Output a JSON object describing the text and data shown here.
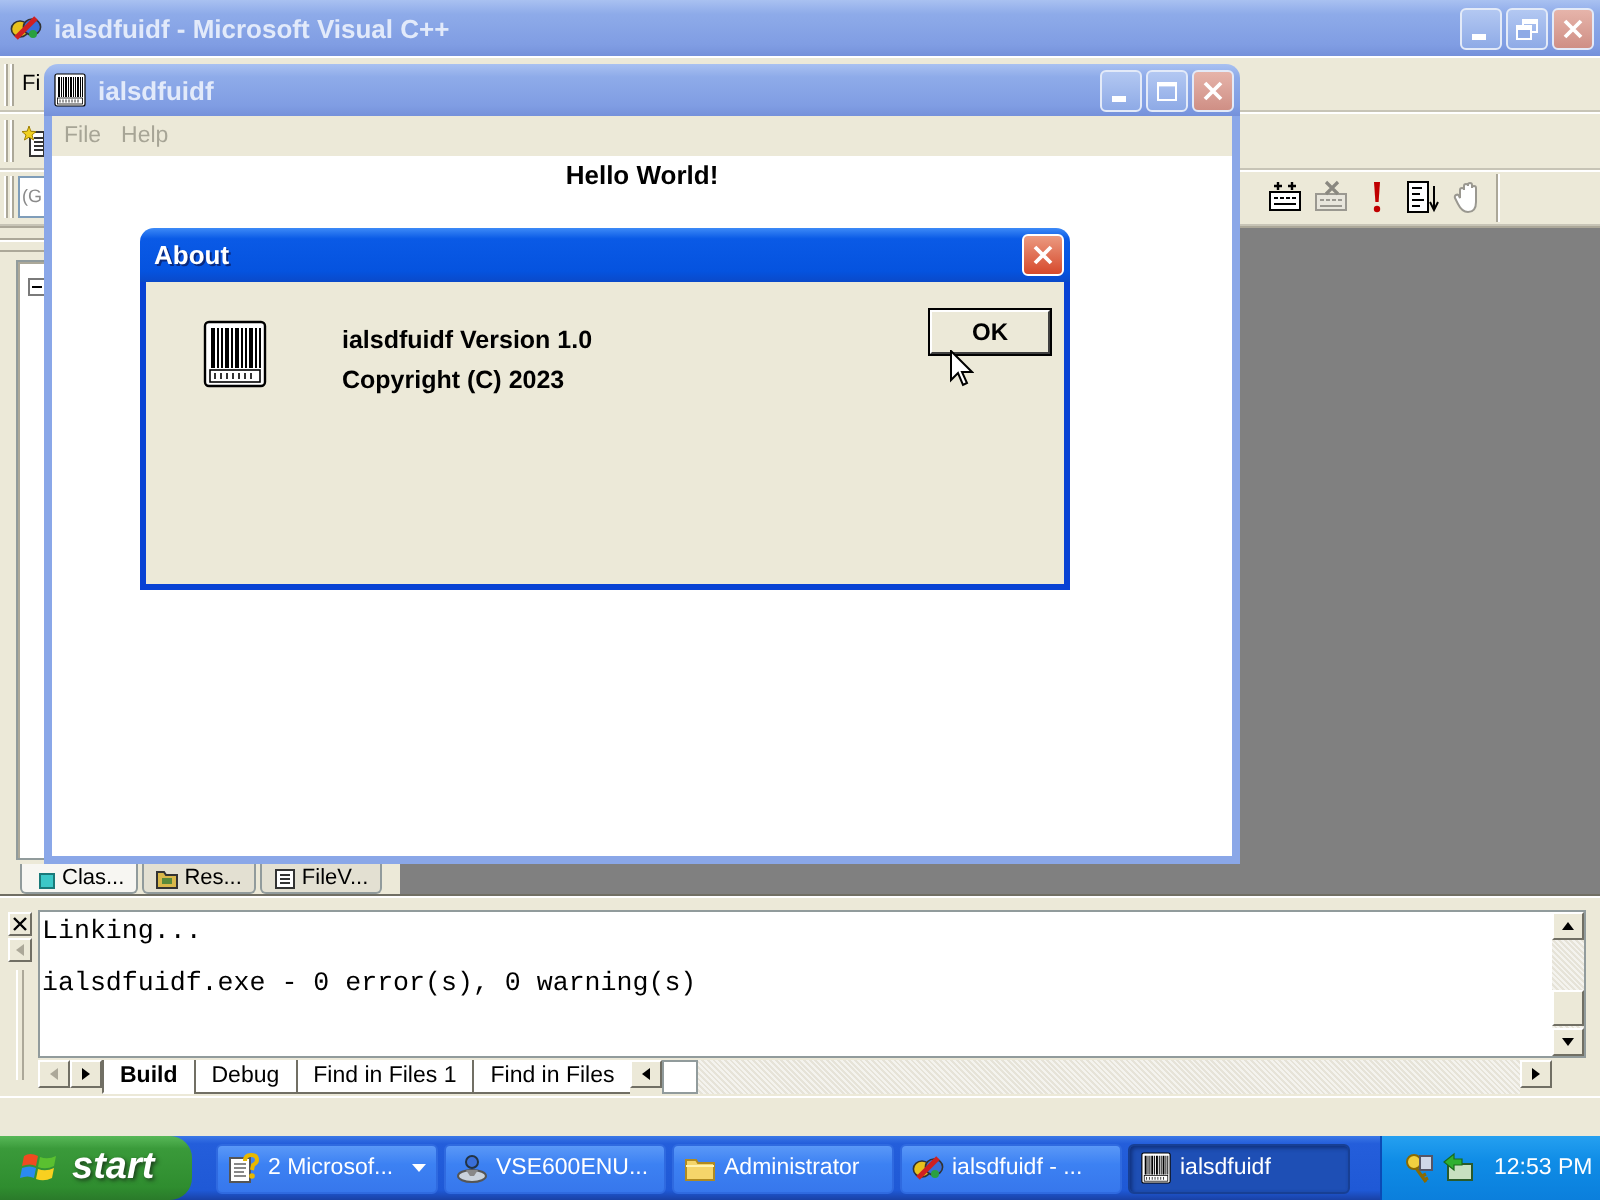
{
  "main_window": {
    "title": "ialsdfuidf - Microsoft Visual C++",
    "active": false,
    "menu_items": [
      "Fi"
    ],
    "combo_value": "(G"
  },
  "workspace_tabs": [
    {
      "label": "Clas...",
      "kind": "class",
      "selected": true
    },
    {
      "label": "Res...",
      "kind": "resource",
      "selected": false
    },
    {
      "label": "FileV...",
      "kind": "file",
      "selected": false
    }
  ],
  "output": {
    "lines": [
      "Linking...",
      "ialsdfuidf.exe - 0 error(s), 0 warning(s)"
    ],
    "tabs": [
      {
        "label": "Build",
        "selected": true
      },
      {
        "label": "Debug",
        "selected": false
      },
      {
        "label": "Find in Files 1",
        "selected": false
      },
      {
        "label": "Find in Files",
        "selected": false
      }
    ]
  },
  "child_window": {
    "title": "ialsdfuidf",
    "active": false,
    "menu": [
      {
        "label": "File",
        "disabled": true
      },
      {
        "label": "Help",
        "disabled": true
      }
    ],
    "message": "Hello World!"
  },
  "about_dialog": {
    "title": "About",
    "active": true,
    "lines": [
      "ialsdfuidf Version 1.0",
      "Copyright (C) 2023"
    ],
    "button": "OK"
  },
  "taskbar": {
    "start": "start",
    "tasks": [
      {
        "label": "2 Microsof...",
        "kind": "help",
        "grouped": true,
        "selected": false
      },
      {
        "label": "VSE600ENU...",
        "kind": "drive",
        "grouped": false,
        "selected": false
      },
      {
        "label": "Administrator",
        "kind": "folder",
        "grouped": false,
        "selected": false
      },
      {
        "label": "ialsdfuidf - ...",
        "kind": "studio",
        "grouped": false,
        "selected": false
      },
      {
        "label": "ialsdfuidf",
        "kind": "barcode",
        "grouped": false,
        "selected": true
      }
    ],
    "clock": "12:53 PM"
  }
}
